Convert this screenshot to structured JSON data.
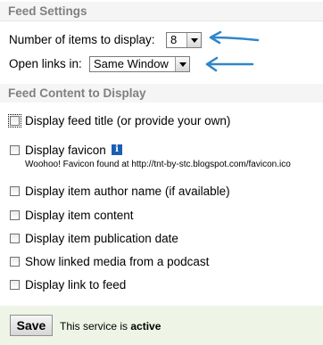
{
  "feed_settings": {
    "header": "Feed Settings",
    "items_label": "Number of items to display:",
    "items_value": "8",
    "links_label": "Open links in:",
    "links_value": "Same Window"
  },
  "feed_content": {
    "header": "Feed Content to Display",
    "options": [
      {
        "label": "Display feed title (or provide your own)",
        "checked": false
      },
      {
        "label": "Display favicon",
        "checked": false
      },
      {
        "label": "Display item author name (if available)",
        "checked": false
      },
      {
        "label": "Display item content",
        "checked": false
      },
      {
        "label": "Display item publication date",
        "checked": false
      },
      {
        "label": "Show linked media from a podcast",
        "checked": false
      },
      {
        "label": "Display link to feed",
        "checked": false
      }
    ],
    "favicon_info_icon": "i",
    "favicon_note": "Woohoo! Favicon found at http://tnt-by-stc.blogspot.com/favicon.ico"
  },
  "footer": {
    "save_label": "Save",
    "status_prefix": "This service is",
    "status_value": "active"
  },
  "annotation_color": "#2f86c9"
}
